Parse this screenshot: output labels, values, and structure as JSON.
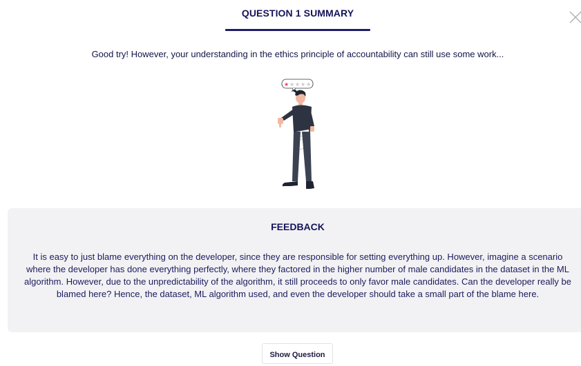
{
  "header": {
    "title": "QUESTION 1 SUMMARY"
  },
  "summary": {
    "message": "Good try! However, your understanding in the ethics principle of accountability can still use some work..."
  },
  "illustration": {
    "icon": "thumbs-down-person-icon",
    "rating_stars_filled": 1,
    "rating_stars_total": 5
  },
  "feedback": {
    "title": "FEEDBACK",
    "text": "It is easy to just blame everything on the developer, since they are responsible for setting everything up. However, imagine a scenario where the developer has done everything perfectly, where they factored in the higher number of male candidates in the dataset in the ML algorithm. However, due to the unpredictability of the algorithm, it still proceeds to only favor male candidates. Can the developer really be blamed here? Hence, the dataset, ML algorithm used, and even the developer should take a small part of the blame here."
  },
  "actions": {
    "show_question_label": "Show Question"
  },
  "colors": {
    "title": "#14145a",
    "underline": "#1c1c6b",
    "panel_bg": "#f2f2f4",
    "accent_star": "#e23c6a"
  }
}
